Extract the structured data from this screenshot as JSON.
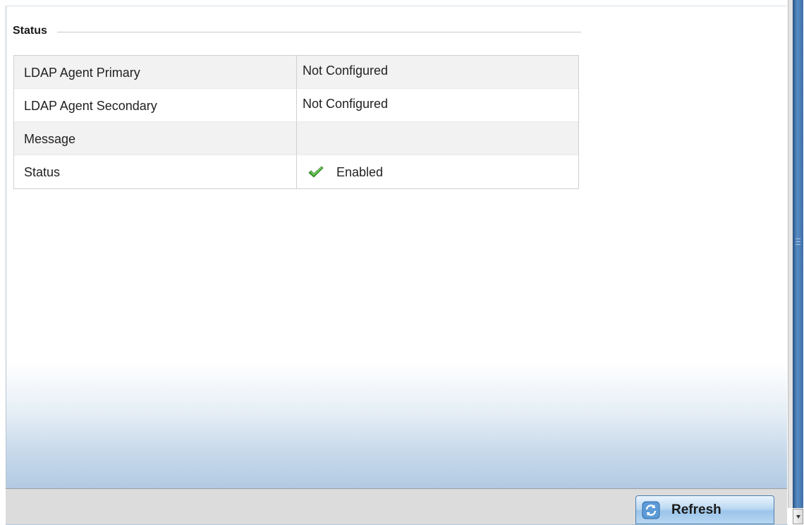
{
  "section": {
    "title": "Status"
  },
  "status_table": {
    "rows": [
      {
        "label": "LDAP Agent Primary",
        "value": "Not Configured"
      },
      {
        "label": "LDAP Agent Secondary",
        "value": "Not Configured"
      },
      {
        "label": "Message",
        "value": ""
      },
      {
        "label": "Status",
        "value": "Enabled",
        "icon": "checkmark-icon"
      }
    ]
  },
  "footer": {
    "refresh_label": "Refresh",
    "refresh_icon": "refresh-icon"
  },
  "colors": {
    "check_green": "#3fa32c",
    "button_border": "#4a7fb0",
    "scroll_thumb": "#3d6ea6"
  }
}
